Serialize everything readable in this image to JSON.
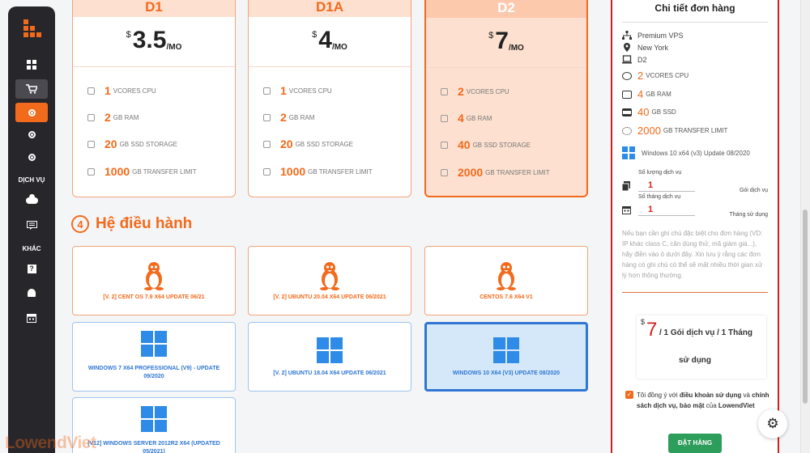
{
  "sidebar": {
    "section_services": "DỊCH VỤ",
    "section_other": "KHÁC",
    "icons": [
      "dashboard-icon",
      "cart-icon",
      "radio-icon",
      "radio-icon",
      "radio-icon",
      "cloud-icon",
      "list-icon",
      "help-icon",
      "bell-icon",
      "calendar-icon"
    ]
  },
  "plans": [
    {
      "name": "D1",
      "currency": "$",
      "price": "3.5",
      "unit": "/MO",
      "cpu": "1",
      "ram": "2",
      "ssd": "20",
      "transfer": "1000"
    },
    {
      "name": "D1A",
      "currency": "$",
      "price": "4",
      "unit": "/MO",
      "cpu": "1",
      "ram": "2",
      "ssd": "20",
      "transfer": "1000"
    },
    {
      "name": "D2",
      "currency": "$",
      "price": "7",
      "unit": "/MO",
      "cpu": "2",
      "ram": "4",
      "ssd": "40",
      "transfer": "2000"
    }
  ],
  "spec_units": {
    "cpu": "VCORES CPU",
    "ram": "GB RAM",
    "ssd": "GB SSD STORAGE",
    "transfer": "GB TRANSFER LIMIT"
  },
  "os_section": {
    "number": "4",
    "title": "Hệ điều hành"
  },
  "os_options": [
    {
      "label": "[V. 2] CENT OS 7.9 X64 UPDATE 06/21",
      "type": "linux"
    },
    {
      "label": "[V. 2] UBUNTU 20.04 X64 UPDATE 06/2021",
      "type": "linux"
    },
    {
      "label": "CENTOS 7.6 X64 V1",
      "type": "linux"
    },
    {
      "label": "WINDOWS 7 X64 PROFESSIONAL (V9) - UPDATE 09/2020",
      "type": "windows"
    },
    {
      "label": "[V. 2] UBUNTU 18.04 X64 UPDATE 06/2021",
      "type": "windows"
    },
    {
      "label": "WINDOWS 10 X64 (V3) UPDATE 08/2020",
      "type": "windows"
    },
    {
      "label": "[V12] WINDOWS SERVER 2012R2 X64 (UPDATED 05/2021)",
      "type": "windows"
    }
  ],
  "order": {
    "title": "Chi tiết đơn hàng",
    "product": "Premium VPS",
    "location": "New York",
    "plan": "D2",
    "cpu": "2",
    "cpu_unit": "VCORES CPU",
    "ram": "4",
    "ram_unit": "GB RAM",
    "ssd": "40",
    "ssd_unit": "GB SSD",
    "transfer": "2000",
    "transfer_unit": "GB TRANSFER LIMIT",
    "os": "Windows 10 x64 (v3) Update 08/2020",
    "qty_label": "Số lượng dịch vụ",
    "qty_value": "1",
    "qty_suffix": "Gói dịch vụ",
    "months_label": "Số tháng dịch vụ",
    "months_value": "1",
    "months_suffix": "Tháng sử dụng",
    "note_placeholder": "Nếu bạn cần ghi chú đặc biệt cho đơn hàng (VD: IP khác class C, cần dùng thử, mã giảm giá...), hãy điền vào ô dưới đây. Xin lưu ý rằng các đơn hàng có ghi chú có thể sẽ mất nhiều thời gian xử lý hơn thông thường.",
    "total_currency": "$",
    "total_amount": "7",
    "total_text": "/ 1 Gói dịch vụ / 1 Tháng",
    "total_text2": "sử dụng",
    "agree_prefix": "Tôi đồng ý với ",
    "agree_terms": "điều khoản sử dụng",
    "agree_and": " và ",
    "agree_policy": "chính sách dịch vụ, bảo mật",
    "agree_of": " của ",
    "agree_brand": "LowendViet",
    "order_button": "ĐẶT HÀNG"
  },
  "watermark": "LowendViet",
  "colors": {
    "accent": "#f26a1b",
    "windows_blue": "#2f76d2",
    "panel_border": "#d41f1f",
    "button_green": "#2d9d5b",
    "sidebar": "#26262b"
  }
}
